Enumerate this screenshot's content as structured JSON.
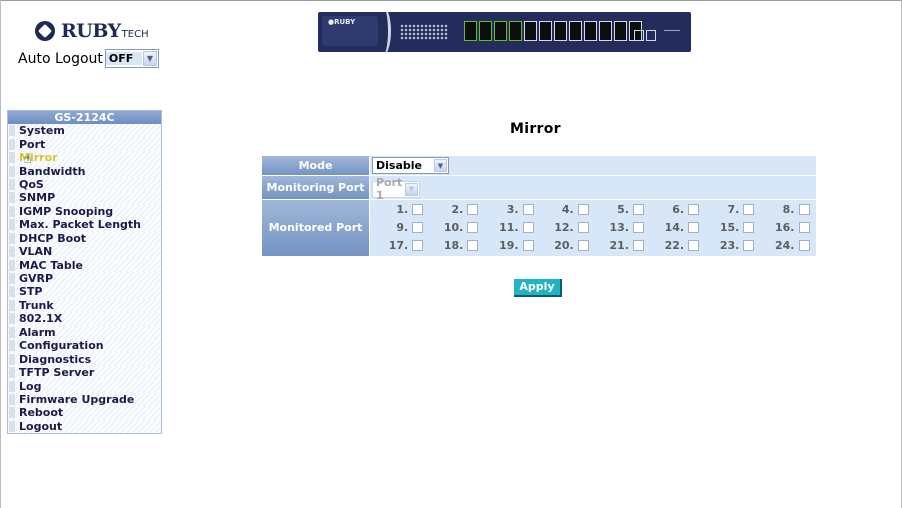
{
  "brand": {
    "name": "RUBY",
    "suffix": "TECH"
  },
  "auto_logout": {
    "label": "Auto Logout",
    "value": "OFF"
  },
  "sidebar": {
    "model": "GS-2124C",
    "items": [
      {
        "label": "System"
      },
      {
        "label": "Port"
      },
      {
        "label": "Mirror",
        "active": true
      },
      {
        "label": "Bandwidth"
      },
      {
        "label": "QoS"
      },
      {
        "label": "SNMP"
      },
      {
        "label": "IGMP Snooping"
      },
      {
        "label": "Max. Packet Length"
      },
      {
        "label": "DHCP Boot"
      },
      {
        "label": "VLAN"
      },
      {
        "label": "MAC Table"
      },
      {
        "label": "GVRP"
      },
      {
        "label": "STP"
      },
      {
        "label": "Trunk"
      },
      {
        "label": "802.1X"
      },
      {
        "label": "Alarm"
      },
      {
        "label": "Configuration"
      },
      {
        "label": "Diagnostics"
      },
      {
        "label": "TFTP Server"
      },
      {
        "label": "Log"
      },
      {
        "label": "Firmware Upgrade"
      },
      {
        "label": "Reboot"
      },
      {
        "label": "Logout"
      }
    ]
  },
  "page": {
    "title": "Mirror"
  },
  "form": {
    "mode_label": "Mode",
    "mode_value": "Disable",
    "monitoring_label": "Monitoring Port",
    "monitoring_value": "Port 1",
    "monitored_label": "Monitored Port",
    "ports": [
      "1.",
      "2.",
      "3.",
      "4.",
      "5.",
      "6.",
      "7.",
      "8.",
      "9.",
      "10.",
      "11.",
      "12.",
      "13.",
      "14.",
      "15.",
      "16.",
      "17.",
      "18.",
      "19.",
      "20.",
      "21.",
      "22.",
      "23.",
      "24."
    ]
  },
  "apply_label": "Apply",
  "colors": {
    "header": "#7493c4",
    "cell": "#d7e7f7",
    "apply": "#22b3c3",
    "active_nav": "#d2c832"
  },
  "icons": [
    "ruby-logo-icon",
    "dropdown-arrow-icon",
    "hand-cursor-icon",
    "switch-device-image"
  ]
}
